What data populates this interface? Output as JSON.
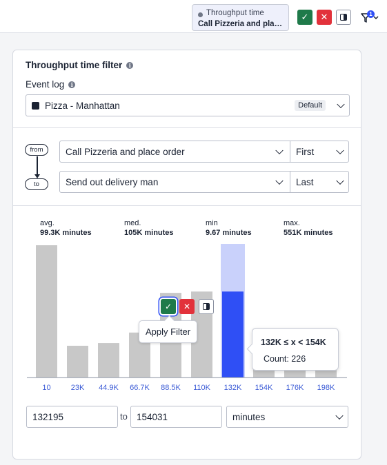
{
  "topbar": {
    "filter_chip": {
      "title": "Throughput time",
      "subtitle": "Call Pizzeria and place order"
    },
    "apply_icon": "check-icon",
    "cancel_icon": "close-icon",
    "invert_icon": "invert-icon",
    "filter_count": "1"
  },
  "panel": {
    "title": "Throughput time filter",
    "event_log": {
      "label": "Event log",
      "value": "Pizza - Manhattan",
      "badge": "Default"
    },
    "from": {
      "pill": "from",
      "activity": "Call Pizzeria and place order",
      "occurrence": "First"
    },
    "to": {
      "pill": "to",
      "activity": "Send out delivery man",
      "occurrence": "Last"
    },
    "stats": [
      {
        "label": "avg.",
        "value": "99.3K minutes"
      },
      {
        "label": "med.",
        "value": "105K minutes"
      },
      {
        "label": "min",
        "value": "9.67 minutes"
      },
      {
        "label": "max.",
        "value": "551K minutes"
      }
    ],
    "apply_tooltip": "Apply Filter",
    "range_tooltip": {
      "range": "132K ≤ x < 154K",
      "count": "Count: 226"
    },
    "range_inputs": {
      "from_value": "132195",
      "to_label": "to",
      "to_value": "154031",
      "unit": "minutes"
    }
  },
  "colors": {
    "accent": "#2f4ff5",
    "selected_band": "#c9d1fb",
    "bar": "#c8c8c8",
    "apply": "#1f7a4a",
    "cancel": "#e2323b"
  },
  "chart_data": {
    "type": "bar",
    "categories": [
      "10",
      "23K",
      "44.9K",
      "66.7K",
      "88.5K",
      "110K",
      "132K",
      "154K",
      "176K",
      "198K"
    ],
    "values": [
      100,
      24,
      26,
      34,
      64,
      65,
      65,
      10,
      8,
      6
    ],
    "selected_index": 6,
    "xlabel": "",
    "ylabel": ""
  }
}
